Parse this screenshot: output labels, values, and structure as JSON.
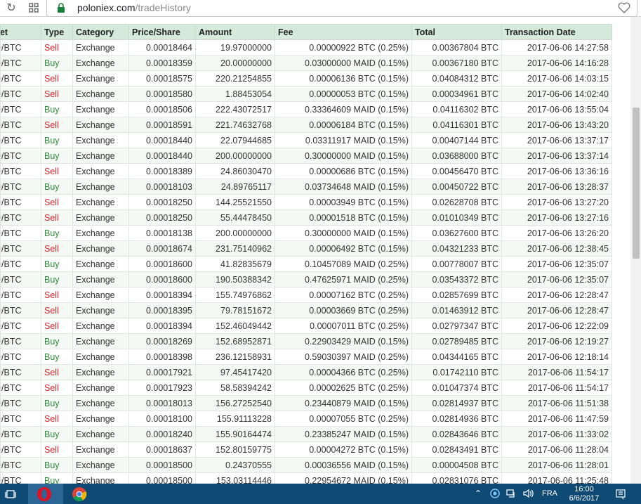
{
  "browser": {
    "url_host": "poloniex.com",
    "url_path": "/tradeHistory"
  },
  "table": {
    "headers": [
      "ket",
      "Type",
      "Category",
      "Price/Share",
      "Amount",
      "Fee",
      "Total",
      "Transaction Date"
    ],
    "rows": [
      [
        "D/BTC",
        "Sell",
        "Exchange",
        "0.00018464",
        "19.97000000",
        "0.00000922 BTC (0.25%)",
        "0.00367804 BTC",
        "2017-06-06 14:27:58"
      ],
      [
        "D/BTC",
        "Buy",
        "Exchange",
        "0.00018359",
        "20.00000000",
        "0.03000000 MAID (0.15%)",
        "0.00367180 BTC",
        "2017-06-06 14:16:28"
      ],
      [
        "D/BTC",
        "Sell",
        "Exchange",
        "0.00018575",
        "220.21254855",
        "0.00006136 BTC (0.15%)",
        "0.04084312 BTC",
        "2017-06-06 14:03:15"
      ],
      [
        "D/BTC",
        "Sell",
        "Exchange",
        "0.00018580",
        "1.88453054",
        "0.00000053 BTC (0.15%)",
        "0.00034961 BTC",
        "2017-06-06 14:02:40"
      ],
      [
        "D/BTC",
        "Buy",
        "Exchange",
        "0.00018506",
        "222.43072517",
        "0.33364609 MAID (0.15%)",
        "0.04116302 BTC",
        "2017-06-06 13:55:04"
      ],
      [
        "D/BTC",
        "Sell",
        "Exchange",
        "0.00018591",
        "221.74632768",
        "0.00006184 BTC (0.15%)",
        "0.04116301 BTC",
        "2017-06-06 13:43:20"
      ],
      [
        "D/BTC",
        "Buy",
        "Exchange",
        "0.00018440",
        "22.07944685",
        "0.03311917 MAID (0.15%)",
        "0.00407144 BTC",
        "2017-06-06 13:37:17"
      ],
      [
        "D/BTC",
        "Buy",
        "Exchange",
        "0.00018440",
        "200.00000000",
        "0.30000000 MAID (0.15%)",
        "0.03688000 BTC",
        "2017-06-06 13:37:14"
      ],
      [
        "D/BTC",
        "Sell",
        "Exchange",
        "0.00018389",
        "24.86030470",
        "0.00000686 BTC (0.15%)",
        "0.00456470 BTC",
        "2017-06-06 13:36:16"
      ],
      [
        "D/BTC",
        "Buy",
        "Exchange",
        "0.00018103",
        "24.89765117",
        "0.03734648 MAID (0.15%)",
        "0.00450722 BTC",
        "2017-06-06 13:28:37"
      ],
      [
        "D/BTC",
        "Sell",
        "Exchange",
        "0.00018250",
        "144.25521550",
        "0.00003949 BTC (0.15%)",
        "0.02628708 BTC",
        "2017-06-06 13:27:20"
      ],
      [
        "D/BTC",
        "Sell",
        "Exchange",
        "0.00018250",
        "55.44478450",
        "0.00001518 BTC (0.15%)",
        "0.01010349 BTC",
        "2017-06-06 13:27:16"
      ],
      [
        "D/BTC",
        "Buy",
        "Exchange",
        "0.00018138",
        "200.00000000",
        "0.30000000 MAID (0.15%)",
        "0.03627600 BTC",
        "2017-06-06 13:26:20"
      ],
      [
        "D/BTC",
        "Sell",
        "Exchange",
        "0.00018674",
        "231.75140962",
        "0.00006492 BTC (0.15%)",
        "0.04321233 BTC",
        "2017-06-06 12:38:45"
      ],
      [
        "D/BTC",
        "Buy",
        "Exchange",
        "0.00018600",
        "41.82835679",
        "0.10457089 MAID (0.25%)",
        "0.00778007 BTC",
        "2017-06-06 12:35:07"
      ],
      [
        "D/BTC",
        "Buy",
        "Exchange",
        "0.00018600",
        "190.50388342",
        "0.47625971 MAID (0.25%)",
        "0.03543372 BTC",
        "2017-06-06 12:35:07"
      ],
      [
        "D/BTC",
        "Sell",
        "Exchange",
        "0.00018394",
        "155.74976862",
        "0.00007162 BTC (0.25%)",
        "0.02857699 BTC",
        "2017-06-06 12:28:47"
      ],
      [
        "D/BTC",
        "Sell",
        "Exchange",
        "0.00018395",
        "79.78151672",
        "0.00003669 BTC (0.25%)",
        "0.01463912 BTC",
        "2017-06-06 12:28:47"
      ],
      [
        "D/BTC",
        "Sell",
        "Exchange",
        "0.00018394",
        "152.46049442",
        "0.00007011 BTC (0.25%)",
        "0.02797347 BTC",
        "2017-06-06 12:22:09"
      ],
      [
        "D/BTC",
        "Buy",
        "Exchange",
        "0.00018269",
        "152.68952871",
        "0.22903429 MAID (0.15%)",
        "0.02789485 BTC",
        "2017-06-06 12:19:27"
      ],
      [
        "D/BTC",
        "Buy",
        "Exchange",
        "0.00018398",
        "236.12158931",
        "0.59030397 MAID (0.25%)",
        "0.04344165 BTC",
        "2017-06-06 12:18:14"
      ],
      [
        "D/BTC",
        "Sell",
        "Exchange",
        "0.00017921",
        "97.45417420",
        "0.00004366 BTC (0.25%)",
        "0.01742110 BTC",
        "2017-06-06 11:54:17"
      ],
      [
        "D/BTC",
        "Sell",
        "Exchange",
        "0.00017923",
        "58.58394242",
        "0.00002625 BTC (0.25%)",
        "0.01047374 BTC",
        "2017-06-06 11:54:17"
      ],
      [
        "D/BTC",
        "Buy",
        "Exchange",
        "0.00018013",
        "156.27252540",
        "0.23440879 MAID (0.15%)",
        "0.02814937 BTC",
        "2017-06-06 11:51:38"
      ],
      [
        "D/BTC",
        "Sell",
        "Exchange",
        "0.00018100",
        "155.91113228",
        "0.00007055 BTC (0.25%)",
        "0.02814936 BTC",
        "2017-06-06 11:47:59"
      ],
      [
        "D/BTC",
        "Buy",
        "Exchange",
        "0.00018240",
        "155.90164474",
        "0.23385247 MAID (0.15%)",
        "0.02843646 BTC",
        "2017-06-06 11:33:02"
      ],
      [
        "D/BTC",
        "Sell",
        "Exchange",
        "0.00018637",
        "152.80159775",
        "0.00004272 BTC (0.15%)",
        "0.02843491 BTC",
        "2017-06-06 11:28:04"
      ],
      [
        "D/BTC",
        "Buy",
        "Exchange",
        "0.00018500",
        "0.24370555",
        "0.00036556 MAID (0.15%)",
        "0.00004508 BTC",
        "2017-06-06 11:28:01"
      ],
      [
        "D/BTC",
        "Buy",
        "Exchange",
        "0.00018500",
        "153.03114446",
        "0.22954672 MAID (0.15%)",
        "0.02831076 BTC",
        "2017-06-06 11:25:48"
      ]
    ]
  },
  "taskbar": {
    "lang": "FRA",
    "time": "16:00",
    "date": "6/6/2017"
  },
  "colors": {
    "sell": "#d8262b",
    "buy": "#2e8b3a",
    "header_bg": "#d6eadb",
    "taskbar_bg": "#0f4a74"
  }
}
